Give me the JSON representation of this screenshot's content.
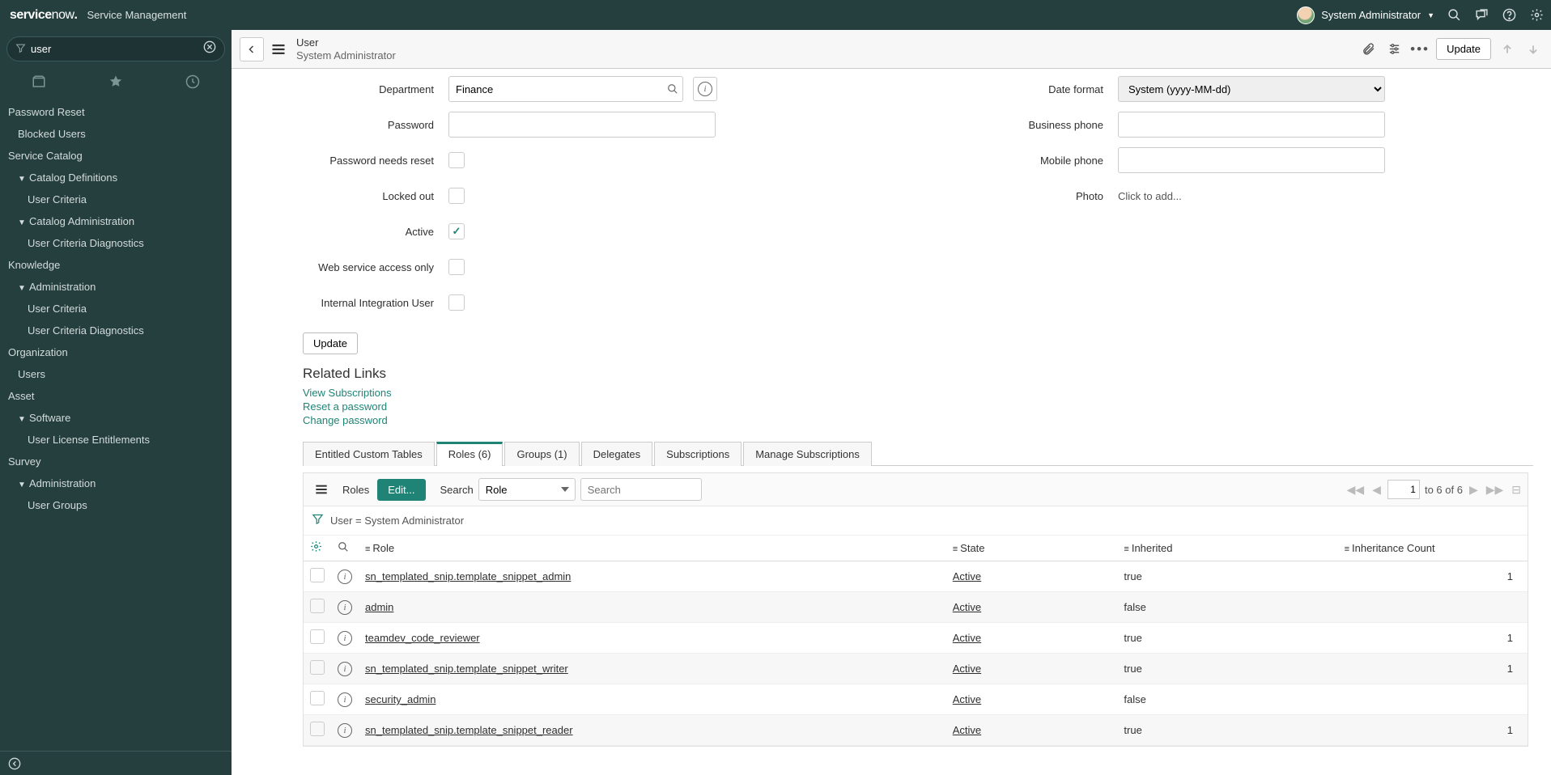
{
  "banner": {
    "product": "service",
    "product2": "now",
    "app": "Service Management",
    "user": "System Administrator"
  },
  "nav": {
    "filter_value": "user",
    "groups": [
      {
        "type": "app",
        "label": "Password Reset"
      },
      {
        "type": "mod",
        "label": "Blocked Users"
      },
      {
        "type": "app",
        "label": "Service Catalog"
      },
      {
        "type": "mod",
        "label": "Catalog Definitions",
        "chev": true
      },
      {
        "type": "sub",
        "label": "User Criteria"
      },
      {
        "type": "mod",
        "label": "Catalog Administration",
        "chev": true
      },
      {
        "type": "sub",
        "label": "User Criteria Diagnostics"
      },
      {
        "type": "app",
        "label": "Knowledge"
      },
      {
        "type": "mod",
        "label": "Administration",
        "chev": true
      },
      {
        "type": "sub",
        "label": "User Criteria"
      },
      {
        "type": "sub",
        "label": "User Criteria Diagnostics"
      },
      {
        "type": "app",
        "label": "Organization"
      },
      {
        "type": "mod",
        "label": "Users"
      },
      {
        "type": "app",
        "label": "Asset"
      },
      {
        "type": "mod",
        "label": "Software",
        "chev": true
      },
      {
        "type": "sub",
        "label": "User License Entitlements"
      },
      {
        "type": "app",
        "label": "Survey"
      },
      {
        "type": "mod",
        "label": "Administration",
        "chev": true
      },
      {
        "type": "sub",
        "label": "User Groups"
      }
    ]
  },
  "header": {
    "table": "User",
    "display": "System Administrator",
    "update": "Update"
  },
  "form": {
    "left": {
      "department_label": "Department",
      "department_value": "Finance",
      "password_label": "Password",
      "password_value": "",
      "needs_reset_label": "Password needs reset",
      "locked_label": "Locked out",
      "active_label": "Active",
      "ws_label": "Web service access only",
      "internal_label": "Internal Integration User"
    },
    "right": {
      "date_label": "Date format",
      "date_value": "System (yyyy-MM-dd)",
      "bphone_label": "Business phone",
      "bphone_value": "",
      "mphone_label": "Mobile phone",
      "mphone_value": "",
      "photo_label": "Photo",
      "photo_link": "Click to add..."
    },
    "update_btn": "Update",
    "related_links_hdr": "Related Links",
    "links": {
      "l1": "View Subscriptions",
      "l2": "Reset a password",
      "l3": "Change password"
    }
  },
  "tabs": {
    "t0": "Entitled Custom Tables",
    "t1": "Roles (6)",
    "t2": "Groups (1)",
    "t3": "Delegates",
    "t4": "Subscriptions",
    "t5": "Manage Subscriptions"
  },
  "rel": {
    "title": "Roles",
    "edit": "Edit...",
    "search_label": "Search",
    "search_field": "Role",
    "search_placeholder": "Search",
    "page": "1",
    "page_text": "to 6 of 6",
    "breadcrumb": "User = System Administrator",
    "cols": {
      "role": "Role",
      "state": "State",
      "inherited": "Inherited",
      "count": "Inheritance Count"
    },
    "rows": [
      {
        "role": "sn_templated_snip.template_snippet_admin",
        "state": "Active",
        "inherited": "true",
        "count": "1"
      },
      {
        "role": "admin",
        "state": "Active",
        "inherited": "false",
        "count": ""
      },
      {
        "role": "teamdev_code_reviewer",
        "state": "Active",
        "inherited": "true",
        "count": "1"
      },
      {
        "role": "sn_templated_snip.template_snippet_writer",
        "state": "Active",
        "inherited": "true",
        "count": "1"
      },
      {
        "role": "security_admin",
        "state": "Active",
        "inherited": "false",
        "count": ""
      },
      {
        "role": "sn_templated_snip.template_snippet_reader",
        "state": "Active",
        "inherited": "true",
        "count": "1"
      }
    ]
  }
}
